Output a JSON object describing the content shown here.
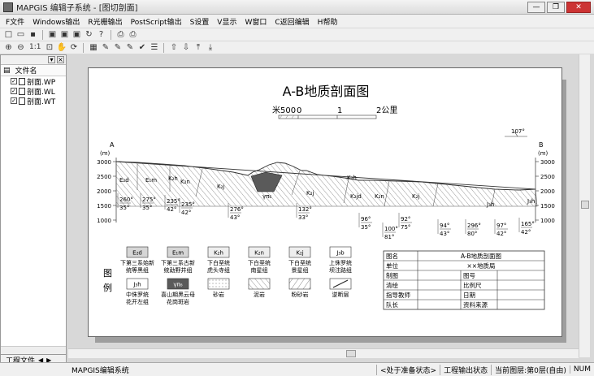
{
  "window": {
    "title": "MAPGIS 编辑子系统 - [图切剖面]"
  },
  "window_buttons": {
    "minimize": "—",
    "restore": "❐",
    "close": "✕"
  },
  "menu": [
    "F文件",
    "Windows输出",
    "R光栅输出",
    "PostScript输出",
    "S设置",
    "V显示",
    "W窗口",
    "C返回编辑",
    "H帮助"
  ],
  "toolbar2": {
    "zoom_label": "1:1"
  },
  "left_panel": {
    "column_header": "文件名",
    "files": [
      {
        "name": "剖面.WP",
        "checked": true
      },
      {
        "name": "剖面.WL",
        "checked": true
      },
      {
        "name": "剖面.WT",
        "checked": true
      }
    ],
    "tab_label": "工程文件"
  },
  "map": {
    "title": "A-B地质剖面图",
    "scale_left": "米500",
    "scale_ticks": [
      "0",
      "1",
      "2公里"
    ],
    "direction_angle": "107°",
    "end_a": "A",
    "end_b": "B",
    "axis_unit": "(m)",
    "elevations": [
      "3000",
      "2500",
      "2000",
      "1500",
      "1000"
    ],
    "strata_labels": [
      "E₂d",
      "E₁m",
      "K₂h",
      "K₂n",
      "K₂j",
      "γπ₆",
      "K₂j",
      "K₂h",
      "K₂jd",
      "K₂n",
      "K₂j",
      "J₃h",
      "J₃h"
    ],
    "attitudes": [
      {
        "dip": "260°",
        "angle": "35°"
      },
      {
        "dip": "275°",
        "angle": "35°"
      },
      {
        "dip": "235°",
        "angle": "42°"
      },
      {
        "dip": "235°",
        "angle": "42°"
      },
      {
        "dip": "276°",
        "angle": "43°"
      },
      {
        "dip": "132°",
        "angle": "33°"
      },
      {
        "dip": "96°",
        "angle": "35°"
      },
      {
        "dip": "100°",
        "angle": "81°"
      },
      {
        "dip": "92°",
        "angle": "75°"
      },
      {
        "dip": "94°",
        "angle": "43°"
      },
      {
        "dip": "296°",
        "angle": "80°"
      },
      {
        "dip": "97°",
        "angle": "42°"
      },
      {
        "dip": "165°",
        "angle": "42°"
      }
    ]
  },
  "legend": {
    "title_chars": [
      "图",
      "例"
    ],
    "items": [
      {
        "code": "E₂d",
        "desc": [
          "下第三系始新",
          "统等黑组"
        ]
      },
      {
        "code": "E₁m",
        "desc": [
          "下第三系古新",
          "统勐野井组"
        ]
      },
      {
        "code": "K₂h",
        "desc": [
          "下白垩统",
          "虎头寺组"
        ]
      },
      {
        "code": "K₂n",
        "desc": [
          "下白垩统",
          "南星组"
        ]
      },
      {
        "code": "K₂j",
        "desc": [
          "下白垩统",
          "景星组"
        ]
      },
      {
        "code": "J₃b",
        "desc": [
          "上侏罗统",
          "坝注路组"
        ]
      },
      {
        "code": "J₃h",
        "desc": [
          "中侏罗统",
          "花开左组"
        ]
      },
      {
        "code": "γπ₆",
        "desc": [
          "喜山期黑云母",
          "花岗斑岩"
        ]
      },
      {
        "code": "",
        "desc": [
          "砂岩"
        ]
      },
      {
        "code": "",
        "desc": [
          "泥岩"
        ]
      },
      {
        "code": "",
        "desc": [
          "粉砂岩"
        ]
      },
      {
        "code": "",
        "desc": [
          "逆断层"
        ]
      }
    ]
  },
  "info_table": {
    "rows": [
      [
        "图名",
        "A-B地质剖面图"
      ],
      [
        "单位",
        "××地质局"
      ],
      [
        "制图",
        "",
        "图号",
        ""
      ],
      [
        "清绘",
        "",
        "比例尺",
        ""
      ],
      [
        "指导教师",
        "",
        "日期",
        ""
      ],
      [
        "队长",
        "",
        "资料来源",
        ""
      ]
    ]
  },
  "status": {
    "app": "MAPGIS编辑系统",
    "state": "<处于准备状态>",
    "project_state": "工程输出状态",
    "layer": "当前图层:第0层(自由)",
    "num": "NUM"
  },
  "colors": {
    "granite_fill": "#5a5a5a",
    "shadow": "#9e9e9e",
    "paper": "#ffffff"
  }
}
